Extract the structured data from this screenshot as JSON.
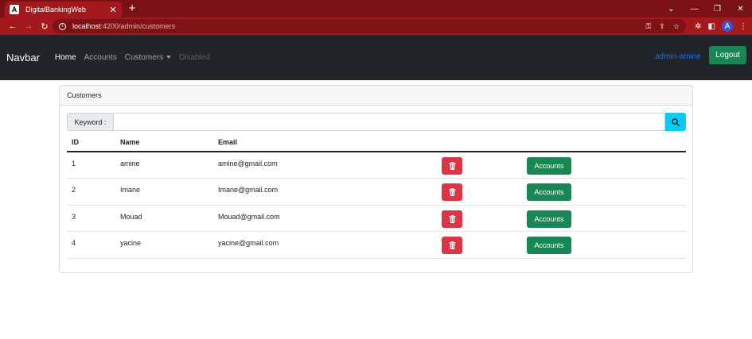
{
  "browser": {
    "tab_title": "DigitalBankingWeb",
    "tab_favicon": "A",
    "close_glyph": "✕",
    "new_tab_glyph": "+",
    "url_host": "localhost",
    "url_path": ":4200/admin/customers",
    "profile_initial": "A",
    "icons": [
      "back-icon",
      "forward-icon",
      "reload-icon",
      "info-icon",
      "key-icon",
      "share-icon",
      "star-icon",
      "extensions-icon",
      "sidepanel-icon",
      "menu-icon"
    ]
  },
  "navbar": {
    "brand": "Navbar",
    "links": [
      {
        "label": "Home"
      },
      {
        "label": "Accounts"
      },
      {
        "label": "Customers"
      },
      {
        "label": "Disabled"
      }
    ],
    "user": "admin-amine",
    "logout_label": "Logout"
  },
  "card": {
    "header": "Customers",
    "keyword_label": "Keyword :",
    "keyword_value": ""
  },
  "table": {
    "headers": [
      "ID",
      "Name",
      "Email"
    ],
    "rows": [
      {
        "id": "1",
        "name": "amine",
        "email": "amine@gmail.com",
        "action": "Accounts"
      },
      {
        "id": "2",
        "name": "Imane",
        "email": "Imane@gmail.com",
        "action": "Accounts"
      },
      {
        "id": "3",
        "name": "Mouad",
        "email": "Mouad@gmail.com",
        "action": "Accounts"
      },
      {
        "id": "4",
        "name": "yacine",
        "email": "yacine@gmail.com",
        "action": "Accounts"
      }
    ]
  },
  "colors": {
    "navbar_bg": "#212529",
    "danger": "#dc3545",
    "success": "#198754",
    "info": "#0dcaf0",
    "link": "#0d6efd"
  }
}
